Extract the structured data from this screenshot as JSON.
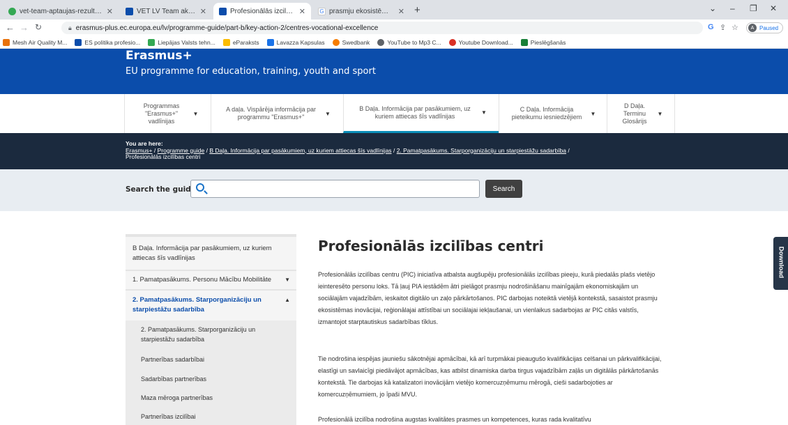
{
  "browser": {
    "tabs": [
      {
        "title": "vet-team-aptaujas-rezultati_ww"
      },
      {
        "title": "VET LV Team aktivitāte | Erasmu"
      },
      {
        "title": "Profesionālās izcilības centri | Era"
      },
      {
        "title": "prasmju ekosistēma - Google Se"
      }
    ],
    "new_tab": "+",
    "url": "erasmus-plus.ec.europa.eu/lv/programme-guide/part-b/key-action-2/centres-vocational-excellence",
    "profile_badge": "Paused",
    "profile_initial": "A",
    "bookmarks": [
      {
        "label": "Mesh Air Quality M...",
        "color": "#e8710a"
      },
      {
        "label": "ES politika profesio...",
        "color": "#0b4dab"
      },
      {
        "label": "Liepājas Valsts tehn...",
        "color": "#34a853"
      },
      {
        "label": "eParaksts",
        "color": "#fbbc04"
      },
      {
        "label": "Lavazza Kapsulas",
        "color": "#1a73e8"
      },
      {
        "label": "Swedbank",
        "color": "#f57c00"
      },
      {
        "label": "YouTube to Mp3 C...",
        "color": "#5f6368"
      },
      {
        "label": "Youtube Download...",
        "color": "#d93025"
      },
      {
        "label": "Pieslēgšanās",
        "color": "#188038"
      }
    ]
  },
  "site": {
    "brand": "Erasmus+",
    "tagline": "EU programme for education, training, youth and sport",
    "accent": "#0b4dab"
  },
  "nav": {
    "items": [
      {
        "label": "Programmas \"Erasmus+\" vadlīnijas"
      },
      {
        "label": "A daļa. Vispārēja informācija par programmu \"Erasmus+\""
      },
      {
        "label": "B Daļa. Informācija par pasākumiem, uz kuriem attiecas šīs vadlīnijas"
      },
      {
        "label": "C Daļa. Informācija pieteikumu iesniedzējiem"
      },
      {
        "label": "D Daļa. Terminu Glosārijs"
      }
    ]
  },
  "breadcrumb": {
    "heading": "You are here:",
    "items": [
      "Erasmus+",
      "Programme guide",
      "B Daļa. Informācija par pasākumiem, uz kuriem attiecas šīs vadlīnijas",
      "2. Pamatpasākums. Starporganizāciju un starpiestāžu sadarbība"
    ],
    "separator": "/",
    "current": "Profesionālās izcilības centri"
  },
  "search": {
    "label": "Search the guide",
    "placeholder": "",
    "button": "Search"
  },
  "download": {
    "label": "Download"
  },
  "sidebar": {
    "header": "B Daļa. Informācija par pasākumiem, uz kuriem attiecas šīs vadlīnijas",
    "items": [
      {
        "label": "1. Pamatpasākums. Personu Mācību Mobilitāte"
      },
      {
        "label": "2. Pamatpasākums. Starporganizāciju un starpiestāžu sadarbība"
      }
    ],
    "subitems": [
      {
        "label": "2. Pamatpasākums. Starporganizāciju un starpiestāžu sadarbība"
      },
      {
        "label": "Partnerības sadarbībai"
      },
      {
        "label": "Sadarbības partnerības"
      },
      {
        "label": "Maza mēroga partnerības"
      },
      {
        "label": "Partnerības izcilībai"
      }
    ]
  },
  "article": {
    "title": "Profesionālās izcilības centri",
    "paragraphs": [
      "Profesionālās izcilības centru (PIC) iniciatīva atbalsta augšupēju profesionālās izcilības pieeju, kurā piedalās plašs vietējo ieinteresēto personu loks. Tā ļauj PIA iestādēm ātri pielāgot prasmju nodrošināšanu mainīgajām ekonomiskajām un sociālajām vajadzībām, ieskaitot digitālo un zaļo pārkārtošanos. PIC darbojas noteiktā vietējā kontekstā, sasaistot prasmju ekosistēmas inovācijai, reģionālajai attīstībai un sociālajai iekļaušanai, un vienlaikus sadarbojas ar PIC citās valstīs, izmantojot starptautiskus sadarbības tīklus.",
      "Tie nodrošina iespējas jauniešu sākotnējai apmācībai, kā arī turpmākai pieaugušo kvalifikācijas celšanai un pārkvalifikācijai, elastīgi un savlaicīgi piedāvājot apmācības, kas atbilst dinamiska darba tirgus vajadzībām zaļās un digitālās pārkārtošanās kontekstā. Tie darbojas kā katalizatori inovācijām vietējo komercuzņēmumu mērogā, cieši sadarbojoties ar komercuzņēmumiem, jo īpaši MVU.",
      "Profesionālā izcilība nodrošina augstas kvalitātes prasmes un kompetences, kuras rada kvalitatīvu"
    ]
  }
}
